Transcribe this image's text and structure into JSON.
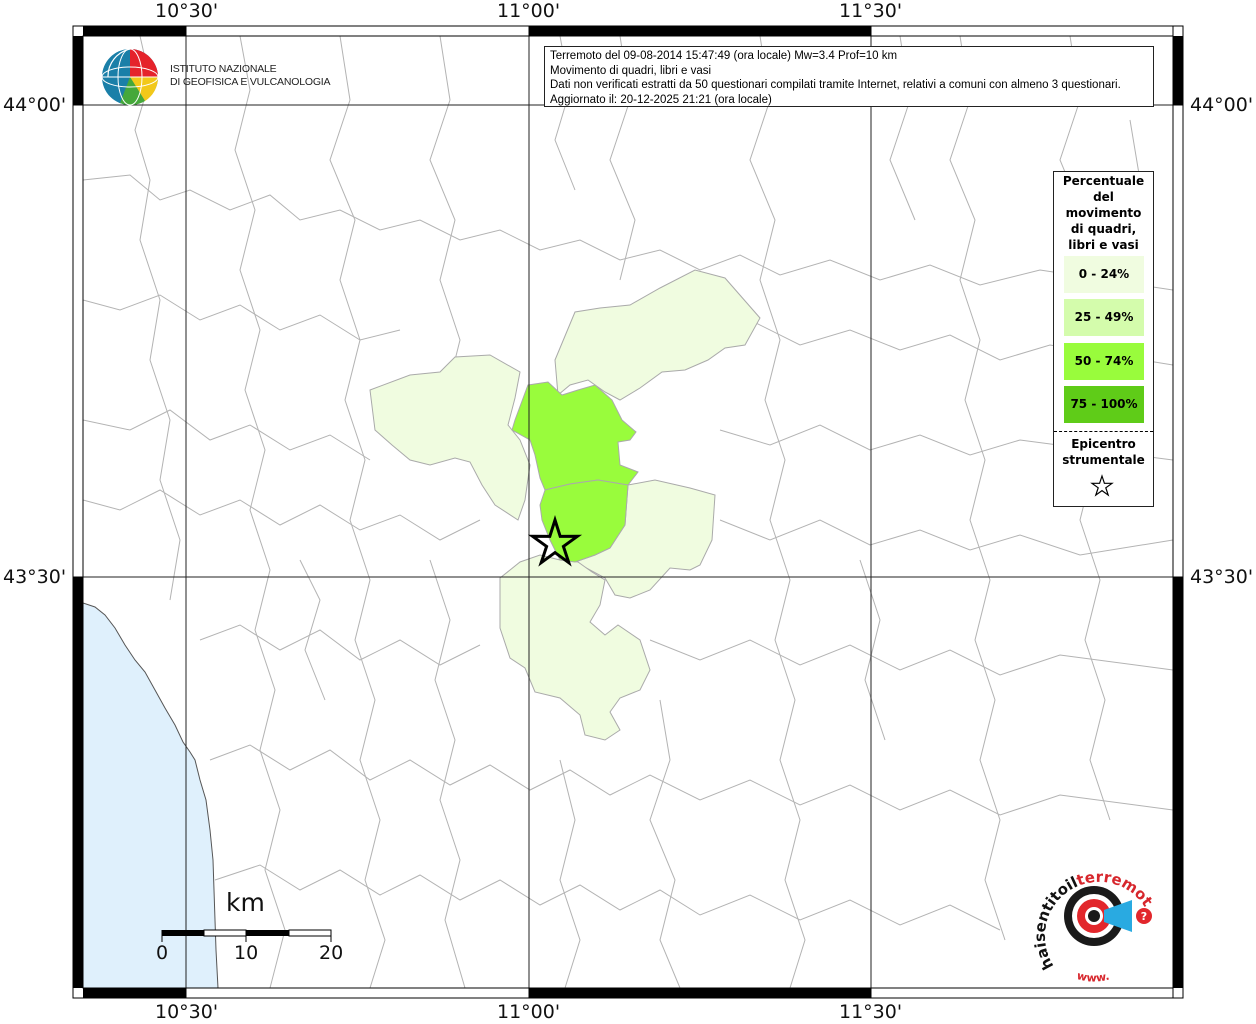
{
  "map": {
    "lon_labels": [
      "10°30'",
      "11°00'",
      "11°30'"
    ],
    "lat_labels": [
      "44°00'",
      "43°30'"
    ]
  },
  "info": {
    "line1": "Terremoto del 09-08-2014 15:47:49 (ora locale) Mw=3.4 Prof=10 km",
    "line2": "Movimento di quadri, libri e vasi",
    "line3": "Dati non verificati estratti da 50 questionari compilati tramite Internet, relativi a comuni con almeno 3 questionari.",
    "line4": "Aggiornato il: 20-12-2025 21:21 (ora locale)"
  },
  "legend": {
    "title_lines": [
      "Percentuale",
      "del",
      "movimento",
      "di quadri,",
      "libri e vasi"
    ],
    "classes": [
      {
        "label": "0 - 24%",
        "color": "#f0fce0"
      },
      {
        "label": "25 - 49%",
        "color": "#d4fcac"
      },
      {
        "label": "50 - 74%",
        "color": "#99fc3c"
      },
      {
        "label": "75 - 100%",
        "color": "#5fcc18"
      }
    ],
    "epicenter_lines": [
      "Epicentro",
      "strumentale"
    ]
  },
  "logo": {
    "line1": "ISTITUTO NAZIONALE",
    "line2": "DI GEOFISICA E VULCANOLOGIA"
  },
  "hst_logo": {
    "text_dark": "haisentitoil",
    "text_red": "terremoto.it",
    "text_www": "www."
  },
  "scale": {
    "unit": "km",
    "labels": [
      "0",
      "10",
      "20"
    ]
  },
  "colors": {
    "sea": "#dff0fc",
    "class1": "#f0fce0",
    "class3": "#99fc3c",
    "border": "#aaaaaa"
  }
}
